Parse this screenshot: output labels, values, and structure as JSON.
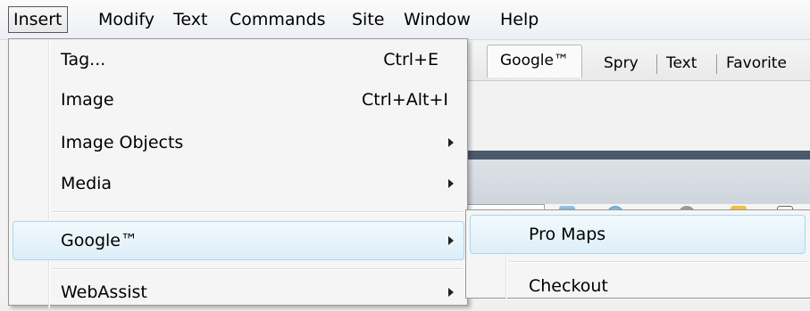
{
  "menubar": {
    "items": [
      "Insert",
      "Modify",
      "Text",
      "Commands",
      "Site",
      "Window",
      "Help"
    ]
  },
  "tabs": [
    "Google™",
    "Spry",
    "Text",
    "Favorite"
  ],
  "insert_menu": {
    "items": [
      {
        "label": "Tag...",
        "shortcut": "Ctrl+E"
      },
      {
        "label": "Image",
        "shortcut": "Ctrl+Alt+I"
      },
      {
        "label": "Image Objects",
        "submenu": true
      },
      {
        "label": "Media",
        "submenu": true
      },
      {
        "label": "Google™",
        "submenu": true,
        "highlighted": true
      },
      {
        "label": "WebAssist",
        "submenu": true
      }
    ]
  },
  "google_submenu": {
    "items": [
      {
        "label": "Pro Maps",
        "highlighted": true
      },
      {
        "label": "Checkout"
      }
    ]
  },
  "colors": {
    "highlight_border": "#a8d8f0",
    "highlight_fill": "#ddeef8",
    "menu_bg": "#f5f5f5",
    "panel_dark": "#4b5a6b"
  }
}
